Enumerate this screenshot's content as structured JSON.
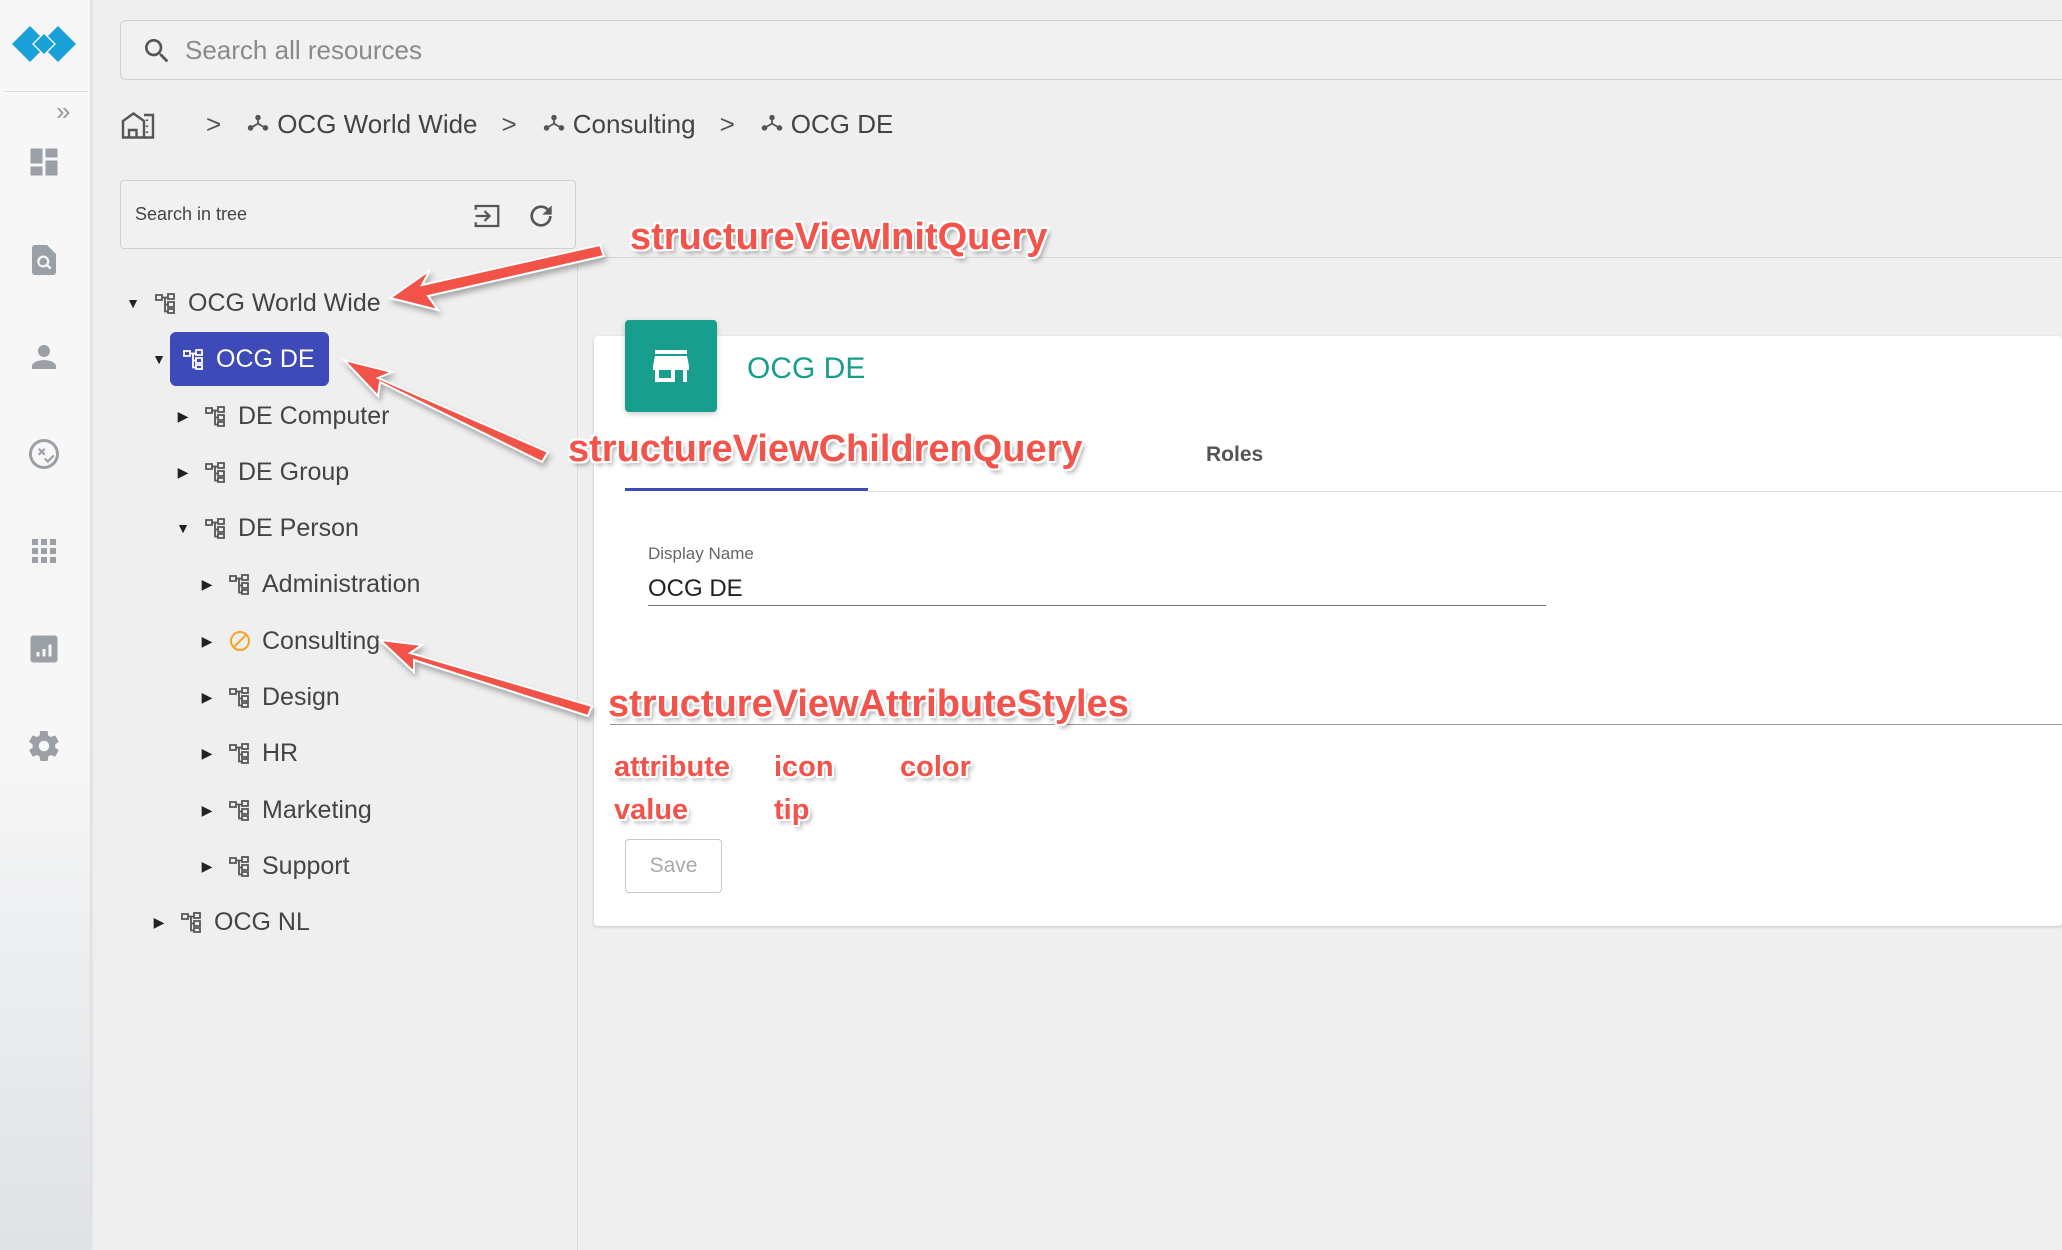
{
  "global_search": {
    "placeholder": "Search all resources"
  },
  "breadcrumb": {
    "items": [
      "OCG World Wide",
      "Consulting",
      "OCG DE"
    ],
    "separator": ">"
  },
  "tree_search": {
    "placeholder": "Search in tree"
  },
  "tree": {
    "nodes": [
      {
        "label": "OCG World Wide",
        "toggle": "▼"
      },
      {
        "label": "OCG DE",
        "toggle": "▼",
        "selected": true
      },
      {
        "label": "DE Computer",
        "toggle": "▶"
      },
      {
        "label": "DE Group",
        "toggle": "▶"
      },
      {
        "label": "DE Person",
        "toggle": "▼"
      },
      {
        "label": "Administration",
        "toggle": "▶"
      },
      {
        "label": "Consulting",
        "toggle": "▶",
        "icon": "blocked-icon"
      },
      {
        "label": "Design",
        "toggle": "▶"
      },
      {
        "label": "HR",
        "toggle": "▶"
      },
      {
        "label": "Marketing",
        "toggle": "▶"
      },
      {
        "label": "Support",
        "toggle": "▶"
      },
      {
        "label": "OCG NL",
        "toggle": "▶"
      }
    ]
  },
  "detail": {
    "title": "OCG DE",
    "icon": "store-icon",
    "tabs": {
      "roles": "Roles"
    },
    "fields": {
      "display_name_label": "Display Name",
      "display_name_value": "OCG DE"
    },
    "save_label": "Save"
  },
  "annotations": {
    "init_query": "structureViewInitQuery",
    "children_query": "structureViewChildrenQuery",
    "attribute_styles": "structureViewAttributeStyles",
    "attribute": "attribute",
    "value": "value",
    "icon": "icon",
    "tip": "tip",
    "color": "color"
  },
  "colors": {
    "accent": "#3e4ab8",
    "teal": "#179e8c",
    "annotation_red": "#f2534a",
    "blocked_orange": "#f5a623",
    "logo_blue": "#1aa1d9"
  }
}
